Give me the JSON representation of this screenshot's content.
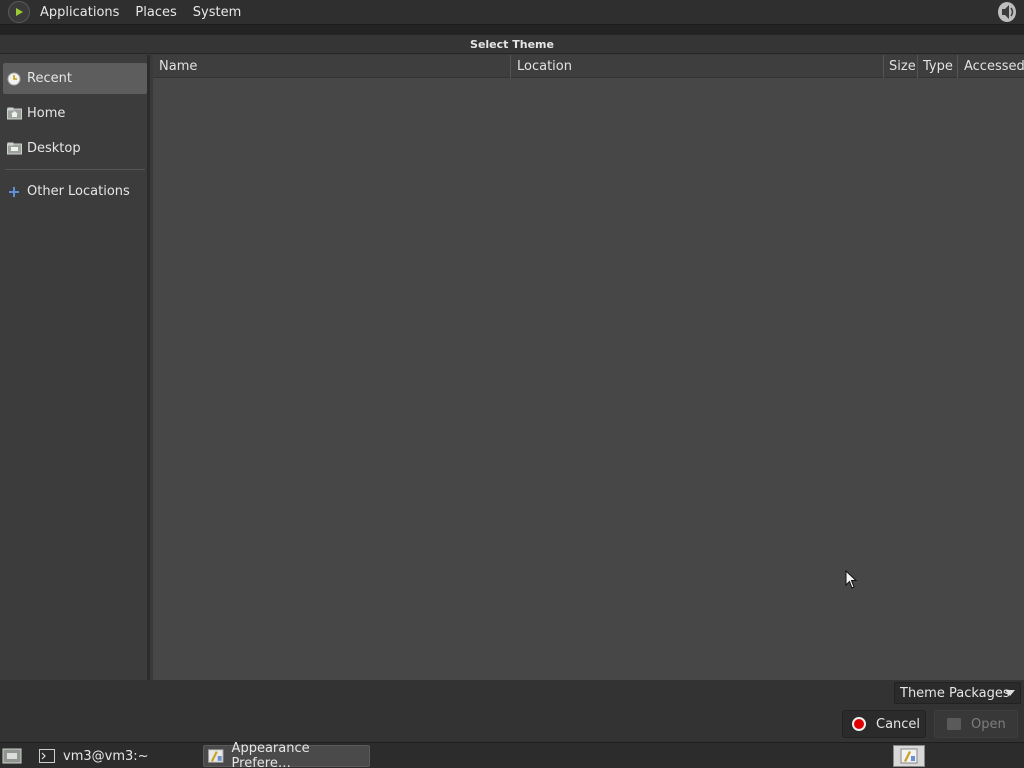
{
  "top_panel": {
    "menus": [
      "Applications",
      "Places",
      "System"
    ],
    "icons": {
      "menu_logo": "gnome-foot-icon",
      "volume": "speaker-volume-icon"
    }
  },
  "dialog": {
    "title": "Select Theme",
    "sidebar": {
      "items": [
        {
          "label": "Recent",
          "icon": "recent-clock-icon",
          "selected": true
        },
        {
          "label": "Home",
          "icon": "home-folder-icon",
          "selected": false
        },
        {
          "label": "Desktop",
          "icon": "desktop-folder-icon",
          "selected": false
        },
        {
          "label": "Other Locations",
          "icon": "plus-locations-icon",
          "selected": false
        }
      ]
    },
    "file_list": {
      "columns": [
        "Name",
        "Location",
        "Size",
        "Type",
        "Accessed"
      ],
      "rows": []
    },
    "filter": {
      "selected": "Theme Packages"
    },
    "buttons": {
      "cancel": "Cancel",
      "open": "Open"
    }
  },
  "taskbar": {
    "tasks": [
      {
        "label": "vm3@vm3:~",
        "icon": "terminal-icon",
        "active": false
      },
      {
        "label": "Appearance Prefere…",
        "icon": "appearance-icon",
        "active": true
      }
    ]
  },
  "colors": {
    "panel": "#2f2f2f",
    "dialog_bg": "#3a3a3a",
    "list_bg": "#474747",
    "selected_row": "#5d5d5d",
    "cancel_red": "#e00000"
  }
}
